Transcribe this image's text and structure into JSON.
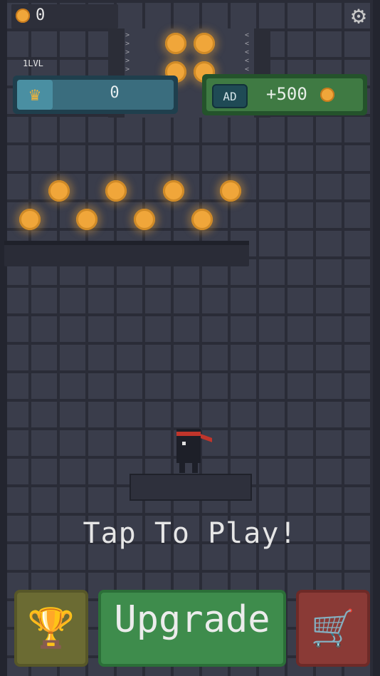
{
  "hud": {
    "coin_count": "0",
    "coin_icon": "coin-icon",
    "settings_icon": "gear-icon"
  },
  "level": {
    "label": "1LVL",
    "value": "0",
    "icon": "crown-icon"
  },
  "ad_reward": {
    "badge": "AD",
    "reward": "+500",
    "icon": "coin-icon"
  },
  "prompt": "Tap To Play!",
  "buttons": {
    "leaderboard_icon": "trophy-icon",
    "upgrade_label": "Upgrade",
    "shop_icon": "cart-icon"
  },
  "colors": {
    "coin": "#f0a63a",
    "level_panel": "#3a6d7e",
    "ad_panel": "#3f7a43",
    "upgrade_button": "#3e8c4c",
    "trophy_button": "#6b6b33",
    "shop_button": "#8a3a36",
    "ninja_band": "#c0352b"
  }
}
